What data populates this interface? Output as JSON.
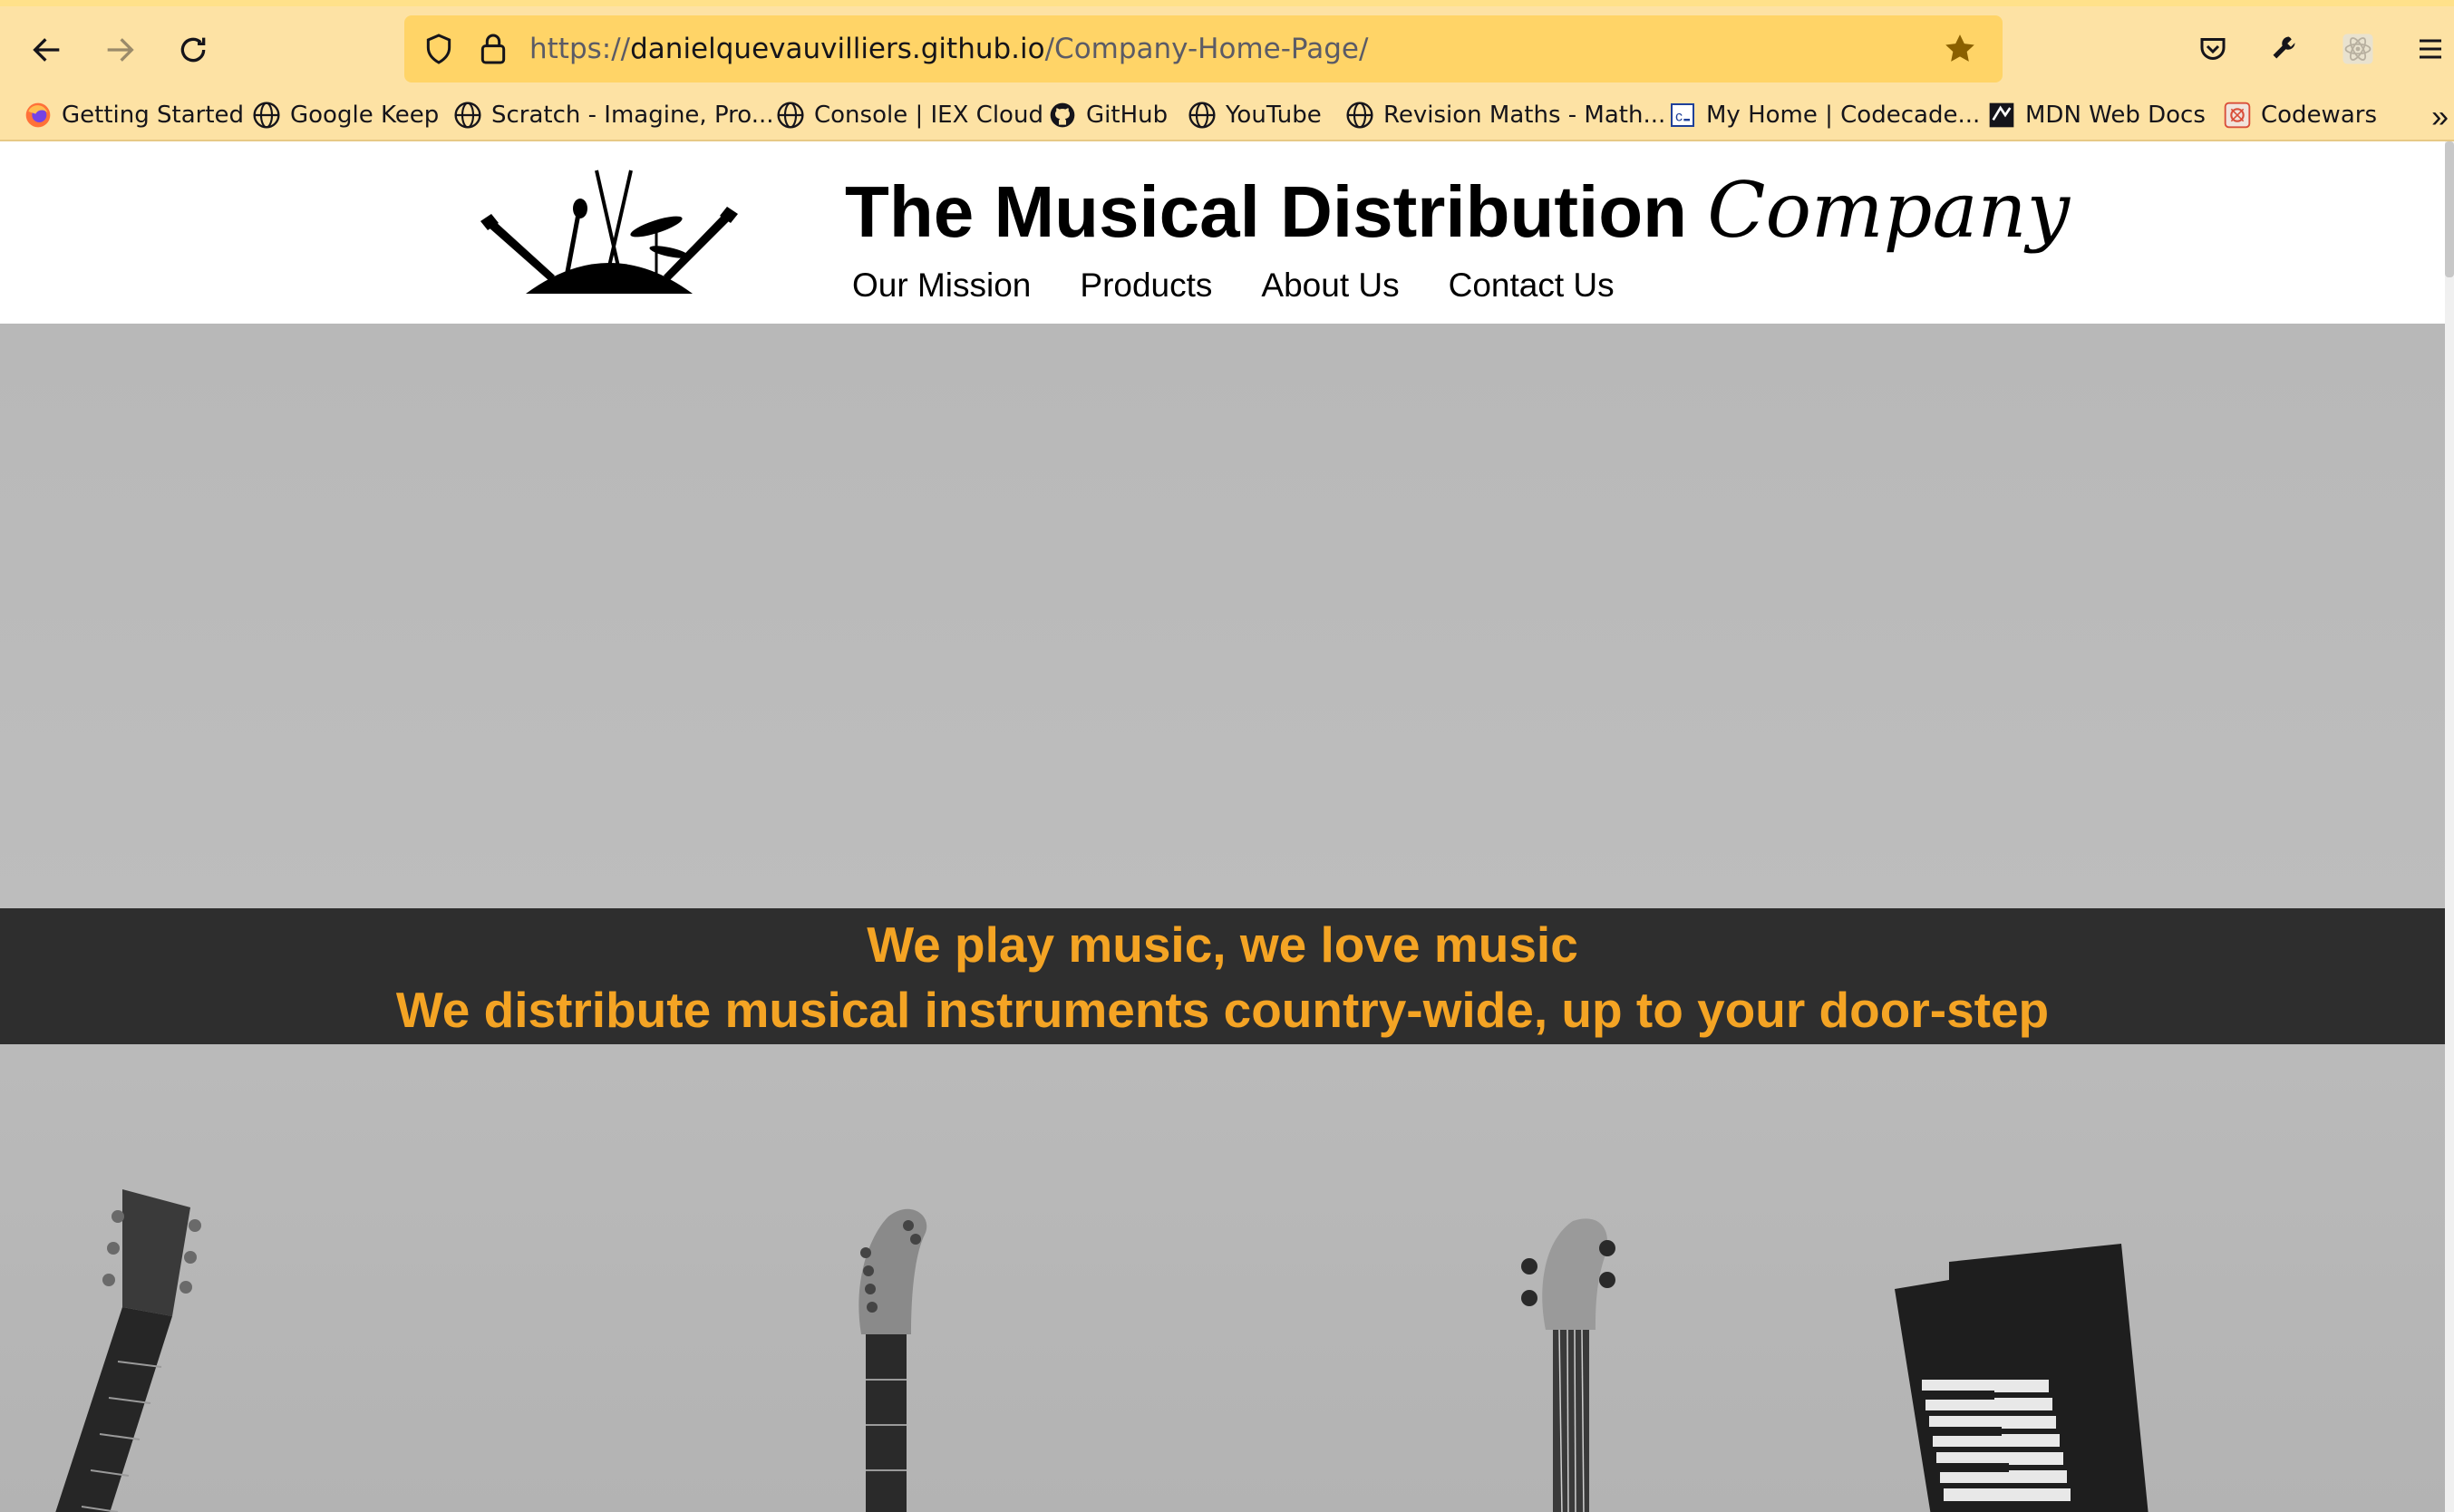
{
  "browser": {
    "url_scheme": "https://",
    "url_host": "danielquevauvilliers.github.io",
    "url_path": "/Company-Home-Page/",
    "accent_color": "#ffd467",
    "bookmarks": [
      {
        "label": "Getting Started",
        "icon": "firefox-icon"
      },
      {
        "label": "Google Keep",
        "icon": "globe-icon"
      },
      {
        "label": "Scratch - Imagine, Pro...",
        "icon": "globe-icon"
      },
      {
        "label": "Console | IEX Cloud",
        "icon": "globe-icon"
      },
      {
        "label": "GitHub",
        "icon": "github-icon"
      },
      {
        "label": "YouTube",
        "icon": "globe-icon"
      },
      {
        "label": "Revision Maths - Math...",
        "icon": "globe-icon"
      },
      {
        "label": "My Home | Codecade...",
        "icon": "codecademy-icon"
      },
      {
        "label": "MDN Web Docs",
        "icon": "mdn-icon"
      },
      {
        "label": "Codewars",
        "icon": "codewars-icon"
      }
    ],
    "more_glyph": "»"
  },
  "site": {
    "title_main": "The Musical Distribution",
    "title_script": "Company",
    "nav": [
      "Our Mission",
      "Products",
      "About Us",
      "Contact Us"
    ],
    "banner_line1": "We play music, we love music",
    "banner_line2": "We distribute musical instruments country-wide, up to your door-step",
    "banner_text_color": "#f4a424",
    "banner_bg_color": "#2e2e2e"
  }
}
